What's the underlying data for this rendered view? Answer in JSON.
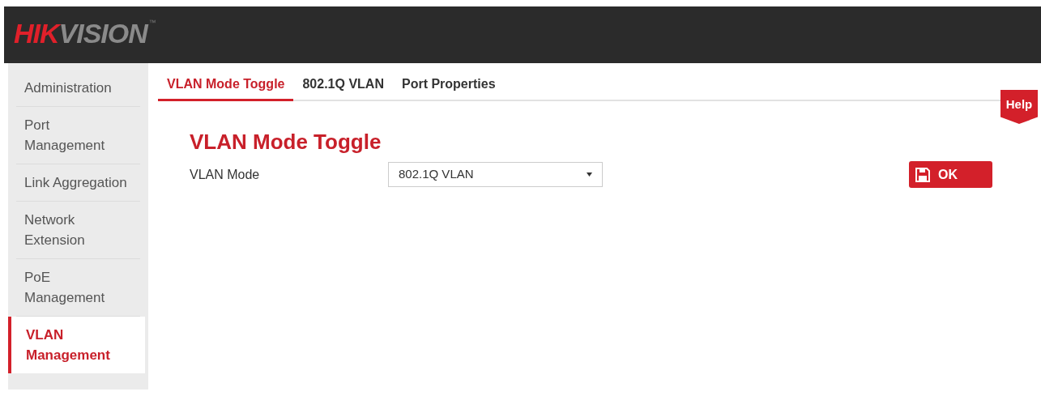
{
  "header": {
    "logo": {
      "brand_red": "HIK",
      "brand_grey": "VISION",
      "trademark": "™"
    }
  },
  "sidebar": {
    "items": [
      {
        "lines": [
          "Administration"
        ],
        "selected": false
      },
      {
        "lines": [
          "Port",
          "Management"
        ],
        "selected": false
      },
      {
        "lines": [
          "Link Aggregation"
        ],
        "selected": false
      },
      {
        "lines": [
          "Network",
          "Extension"
        ],
        "selected": false
      },
      {
        "lines": [
          "PoE",
          "Management"
        ],
        "selected": false
      },
      {
        "lines": [
          "VLAN",
          "Management"
        ],
        "selected": true
      }
    ]
  },
  "tabs": [
    {
      "label": "VLAN Mode Toggle",
      "selected": true
    },
    {
      "label": "802.1Q VLAN",
      "selected": false
    },
    {
      "label": "Port Properties",
      "selected": false
    }
  ],
  "help": "Help",
  "section": {
    "title": "VLAN Mode Toggle",
    "field_label": "VLAN Mode",
    "select_value": "802.1Q VLAN"
  },
  "ok_button": "OK"
}
